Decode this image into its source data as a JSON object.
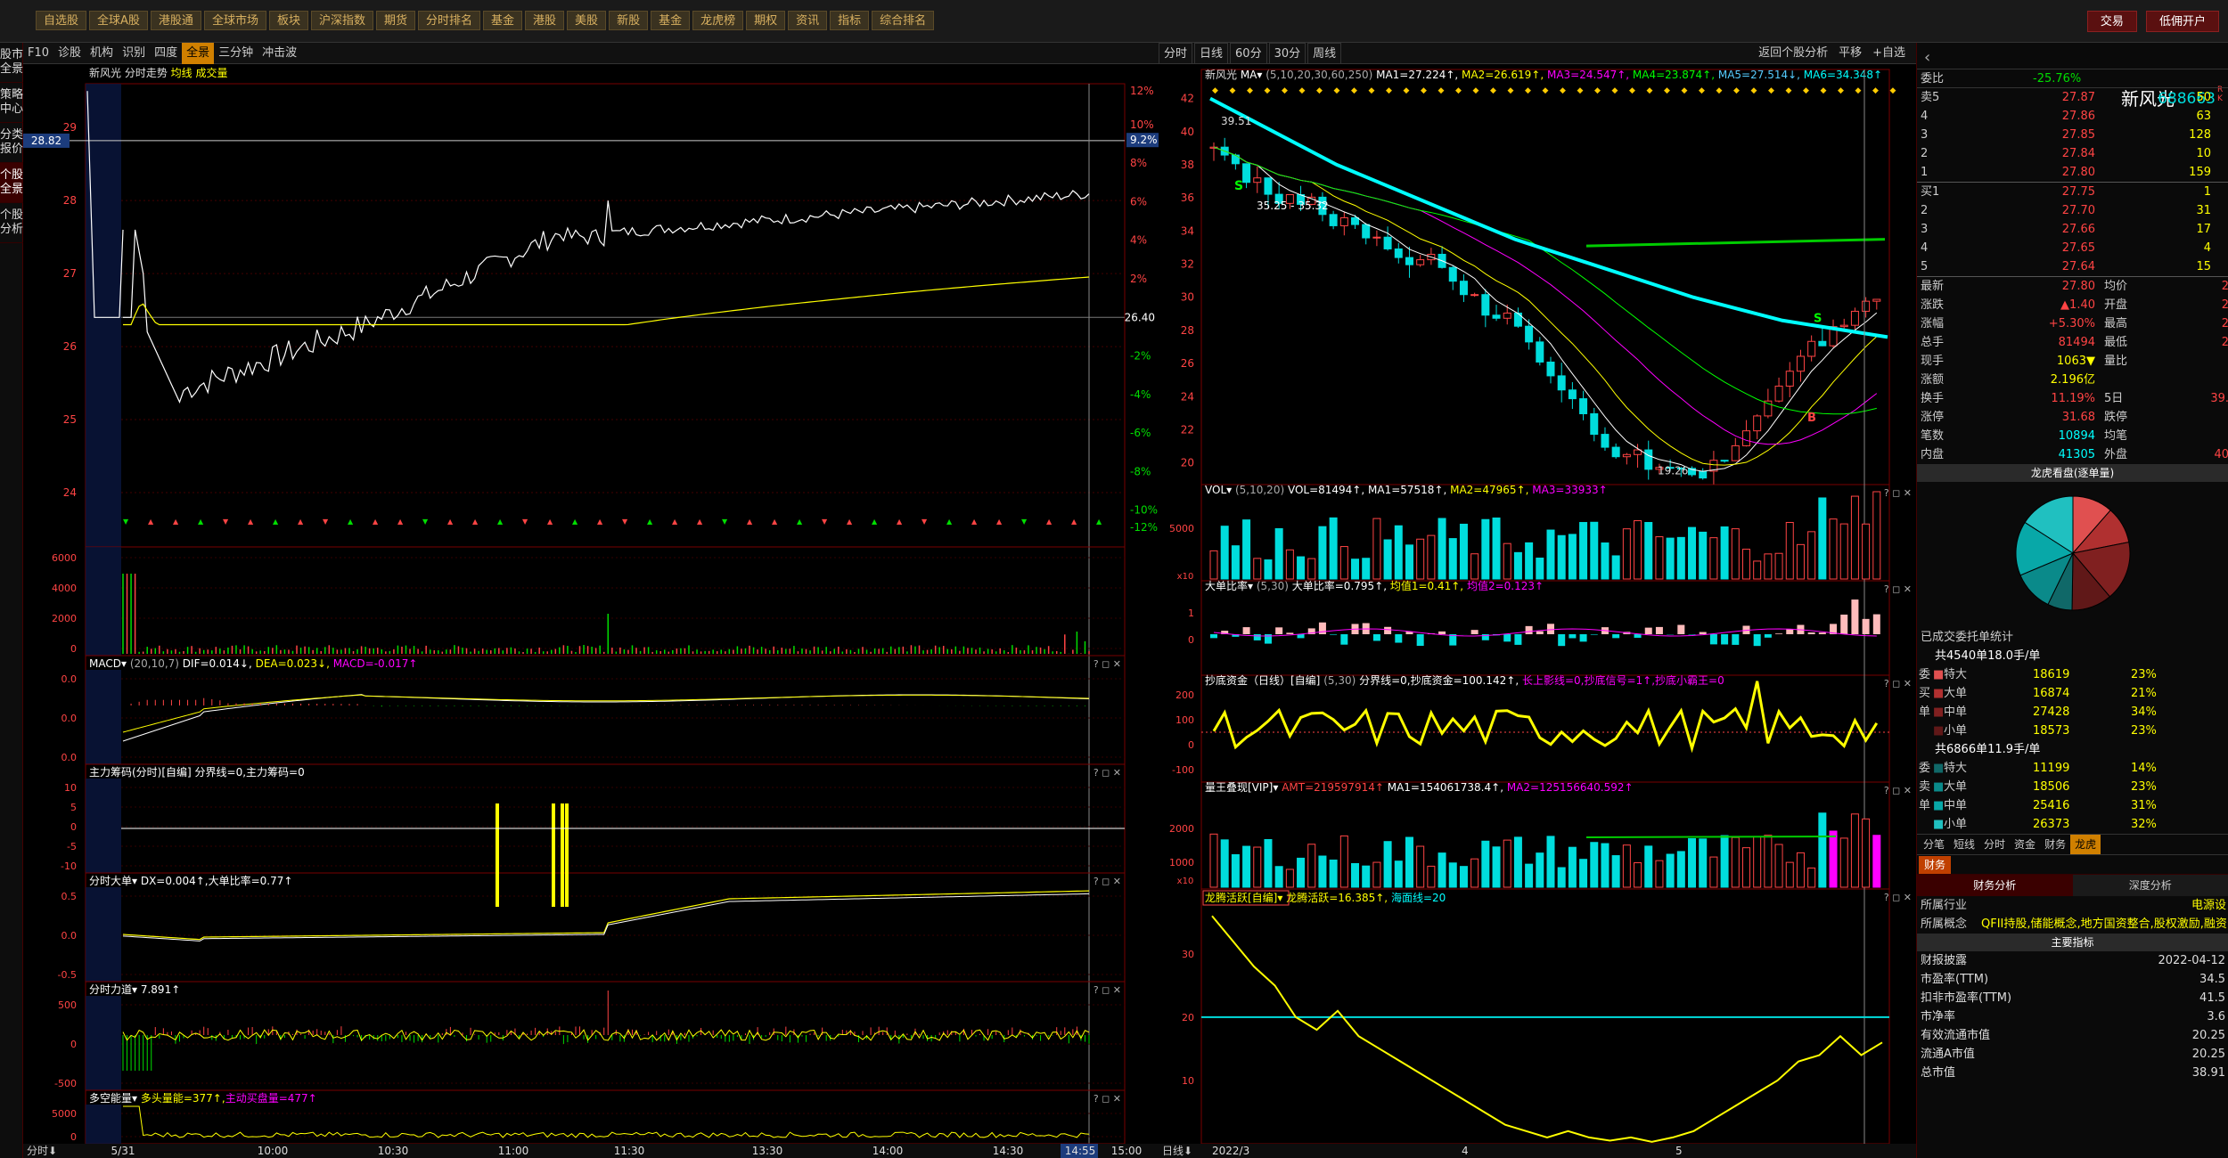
{
  "topbar": {
    "items": [
      "自选股",
      "全球A股",
      "港股通",
      "全球市场",
      "板块",
      "沪深指数",
      "期货",
      "分时排名",
      "基金",
      "港股",
      "美股",
      "新股",
      "基金",
      "龙虎榜",
      "期权",
      "资讯",
      "指标",
      "综合排名"
    ],
    "trade": "交易",
    "account": "低佣开户"
  },
  "sidebar": {
    "items": [
      "股市全景",
      "策略中心",
      "分类报价",
      "个股全景",
      "个股分析"
    ]
  },
  "intraday_toolbar": {
    "items": [
      "F10",
      "诊股",
      "机构",
      "识别",
      "四度",
      "全景",
      "三分钟",
      "冲击波"
    ],
    "active": "全景"
  },
  "kline_toolbar": {
    "items": [
      "分时",
      "日线",
      "60分",
      "30分",
      "周线"
    ],
    "right": [
      "返回个股分析",
      "平移",
      "+自选"
    ]
  },
  "intraday": {
    "title": "新风光",
    "subtitle": "分时走势",
    "legend": "均线 成交量",
    "price_label": "28.82",
    "prev_close": "26.40",
    "y_left": [
      "29",
      "28",
      "27",
      "26",
      "25",
      "24"
    ],
    "y_right": [
      "12%",
      "10%",
      "9.2%",
      "8%",
      "6%",
      "4%",
      "2%",
      "-2%",
      "-4%",
      "-6%",
      "-8%",
      "-10%",
      "-12%"
    ],
    "vol": {
      "ticks": [
        "6000",
        "4000",
        "2000",
        "0"
      ]
    },
    "macd": {
      "label": "MACD",
      "params": "(20,10,7)",
      "dif": "DIF=0.014↓",
      "dea": "DEA=0.023↓",
      "macd": "MACD=-0.017↑",
      "ticks": [
        "0.0",
        "0.0",
        "0.0"
      ]
    },
    "main_force": {
      "label": "主力筹码(分时)[自编]",
      "text": "分界线=0,主力筹码=0",
      "ticks": [
        "10",
        "5",
        "0",
        "-5",
        "-10"
      ]
    },
    "big_order": {
      "label": "分时大单",
      "text": "DX=0.004↑,大单比率=0.77↑",
      "ticks": [
        "0.5",
        "0.0",
        "-0.5"
      ]
    },
    "force": {
      "label": "分时力道",
      "text": "7.891↑",
      "ticks": [
        "500",
        "0",
        "-500"
      ]
    },
    "energy": {
      "label": "多空能量",
      "text": "多头量能=377↑,",
      "text2": "主动买盘量=477↑",
      "ticks": [
        "5000",
        "0"
      ]
    },
    "time_axis": [
      "5/31",
      "10:00",
      "10:30",
      "11:00",
      "11:30",
      "13:30",
      "14:00",
      "14:30",
      "14:55",
      "15:00"
    ],
    "time_mode": "分时"
  },
  "kline": {
    "title": "新风光",
    "ma_label": "MA",
    "ma_params": "(5,10,20,30,60,250)",
    "ma1": "MA1=27.224↑",
    "ma2": "MA2=26.619↑",
    "ma3": "MA3=24.547↑",
    "ma4": "MA4=23.874↑",
    "ma5": "MA5=27.514↓",
    "ma6": "MA6=34.348↑",
    "y": [
      "42",
      "40",
      "38",
      "36",
      "34",
      "32",
      "30",
      "28",
      "26",
      "24",
      "22",
      "20"
    ],
    "high_label": "39.51",
    "range_label": "35.25 - 35.32",
    "low_label": "19.26",
    "vol": {
      "label": "VOL",
      "params": "(5,10,20)",
      "vol": "VOL=81494↑",
      "ma1": "MA1=57518↑",
      "ma2": "MA2=47965↑",
      "ma3": "MA3=33933↑",
      "ticks": [
        "5000"
      ],
      "unit": "x10"
    },
    "big": {
      "label": "大单比率",
      "params": "(5,30)",
      "t1": "大单比率=0.795↑",
      "t2": "均值1=0.41↑",
      "t3": "均值2=0.123↑",
      "ticks": [
        "1",
        "0"
      ]
    },
    "bottom": {
      "label": "抄底资金（日线）[自编]",
      "params": "(5,30)",
      "t1": "分界线=0,抄底资金=100.142↑",
      "t2": "长上影线=0,抄底信号=1↑,抄底小霸王=0",
      "ticks": [
        "200",
        "100",
        "0",
        "-100"
      ]
    },
    "qty": {
      "label": "量王叠现[VIP]",
      "t1": "AMT=219597914↑",
      "t2": "MA1=154061738.4↑",
      "t3": "MA2=125156640.592↑",
      "ticks": [
        "2000",
        "1000"
      ],
      "unit": "x10"
    },
    "dragon": {
      "label": "龙腾活跃[自编]",
      "t1": "龙腾活跃=16.385↑",
      "t2": "海面线=20",
      "ticks": [
        "30",
        "20",
        "10"
      ]
    },
    "x_axis": [
      "2022/3",
      "4",
      "5"
    ],
    "mode": "日线"
  },
  "right": {
    "name": "新风光",
    "code": "688663",
    "tag": "R K",
    "webi": "委比",
    "webi_val": "-25.76%",
    "asks": [
      [
        "卖5",
        "27.87",
        "50"
      ],
      [
        "4",
        "27.86",
        "63"
      ],
      [
        "3",
        "27.85",
        "128"
      ],
      [
        "2",
        "27.84",
        "10"
      ],
      [
        "1",
        "27.80",
        "159"
      ]
    ],
    "bids": [
      [
        "买1",
        "27.75",
        "1"
      ],
      [
        "2",
        "27.70",
        "31"
      ],
      [
        "3",
        "27.66",
        "17"
      ],
      [
        "4",
        "27.65",
        "4"
      ],
      [
        "5",
        "27.64",
        "15"
      ]
    ],
    "stats": [
      [
        "最新",
        "27.80",
        "均价",
        "2"
      ],
      [
        "涨跌",
        "▲1.40",
        "开盘",
        "2"
      ],
      [
        "涨幅",
        "+5.30%",
        "最高",
        "2"
      ],
      [
        "总手",
        "81494",
        "最低",
        "2"
      ],
      [
        "现手",
        "1063▼",
        "量比",
        ""
      ],
      [
        "涨额",
        "2.196亿",
        "",
        ""
      ],
      [
        "换手",
        "11.19%",
        "5日",
        "39."
      ],
      [
        "涨停",
        "31.68",
        "跌停",
        ""
      ],
      [
        "笔数",
        "10894",
        "均笔",
        ""
      ],
      [
        "内盘",
        "41305",
        "外盘",
        "40"
      ]
    ],
    "dragon_title": "龙虎看盘(逐单量)",
    "entrust": "已成交委托单统计",
    "buy_total": "共4540单18.0手/单",
    "sell_total": "共6866单11.9手/单",
    "buy_rows": [
      [
        "特大",
        "18619",
        "23%"
      ],
      [
        "大单",
        "16874",
        "21%"
      ],
      [
        "中单",
        "27428",
        "34%"
      ],
      [
        "小单",
        "18573",
        "23%"
      ]
    ],
    "sell_rows": [
      [
        "特大",
        "11199",
        "14%"
      ],
      [
        "大单",
        "18506",
        "23%"
      ],
      [
        "中单",
        "25416",
        "31%"
      ],
      [
        "小单",
        "26373",
        "32%"
      ]
    ],
    "tabs": [
      "分笔",
      "短线",
      "分时",
      "资金",
      "财务",
      "龙虎"
    ],
    "tab_active": "龙虎",
    "fin_tab": "财务",
    "fin_sub": [
      "财务分析",
      "深度分析"
    ],
    "industry_l": "所属行业",
    "industry_v": "电源设",
    "concept_l": "所属概念",
    "concept_v": "QFII持股,储能概念,地方国资整合,股权激励,融资",
    "indicator_title": "主要指标",
    "fin": [
      [
        "财报披露",
        "2022-04-12"
      ],
      [
        "市盈率(TTM)",
        "34.5"
      ],
      [
        "扣非市盈率(TTM)",
        "41.5"
      ],
      [
        "市净率",
        "3.6"
      ],
      [
        "有效流通市值",
        "20.25"
      ],
      [
        "流通A市值",
        "20.25"
      ],
      [
        "总市值",
        "38.91"
      ]
    ]
  }
}
